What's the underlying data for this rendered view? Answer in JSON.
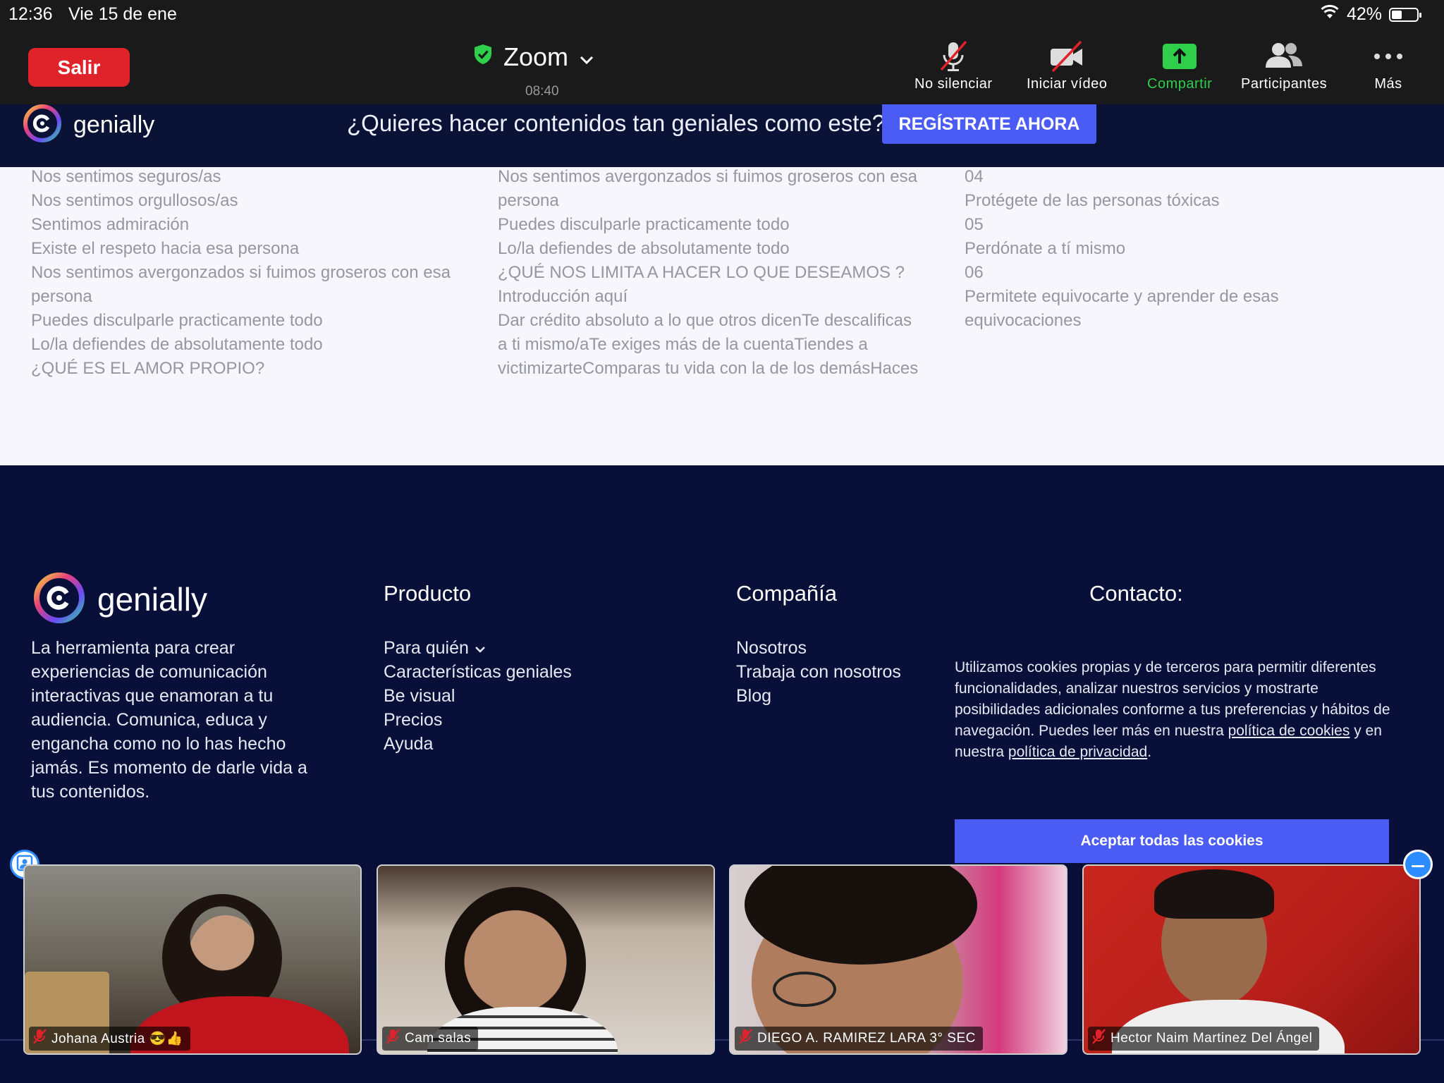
{
  "status_bar": {
    "time": "12:36",
    "date": "Vie 15 de ene",
    "battery": "42%",
    "battery_level": 0.42
  },
  "toolbar": {
    "leave_label": "Salir",
    "meeting_title": "Zoom",
    "meeting_time": "08:40",
    "tools": {
      "unmute": "No silenciar",
      "start_video": "Iniciar vídeo",
      "share": "Compartir",
      "participants": "Participantes",
      "more": "Más"
    },
    "share_color": "#2fcf4c",
    "leave_color": "#e0232a"
  },
  "promo": {
    "brand": "genially",
    "text": "¿Quieres hacer contenidos tan geniales como este?",
    "cta": "REGÍSTRATE AHORA"
  },
  "content": {
    "col1": [
      "Nos sentimos seguros/as",
      "Nos sentimos orgullosos/as",
      "Sentimos admiración",
      "Existe el respeto hacia esa persona",
      "Nos sentimos avergonzados si fuimos groseros con esa",
      "persona",
      "Puedes disculparle practicamente todo",
      "Lo/la defiendes de absolutamente todo",
      "¿QUÉ ES EL AMOR PROPIO?"
    ],
    "col2": [
      "Nos sentimos avergonzados si fuimos groseros con esa",
      "persona",
      "Puedes disculparle practicamente todo",
      "Lo/la defiendes de absolutamente todo",
      "¿QUÉ NOS LIMITA A HACER LO QUE DESEAMOS ?",
      "Introducción aquí",
      "Dar crédito absoluto a lo que otros dicenTe descalificas",
      "a ti mismo/aTe exiges más de la cuentaTiendes a",
      "victimizarteComparas tu vida con la de los demásHaces"
    ],
    "col3": [
      "04",
      "Protégete de las personas tóxicas",
      "05",
      "Perdónate a tí mismo",
      "06",
      "Permitete equivocarte y aprender de esas",
      "equivocaciones"
    ]
  },
  "footer": {
    "brand": "genially",
    "about": "La herramienta para crear experiencias de comunicación interactivas que enamoran a tu audiencia. Comunica, educa y engancha como no lo has hecho jamás. Es momento de darle vida a tus contenidos.",
    "product": {
      "title": "Producto",
      "links": [
        "Para quién",
        "Características geniales",
        "Be visual",
        "Precios",
        "Ayuda"
      ]
    },
    "company": {
      "title": "Compañía",
      "links": [
        "Nosotros",
        "Trabaja con nosotros",
        "Blog"
      ]
    },
    "contact": {
      "title": "Contacto:"
    },
    "cookies": {
      "text_1": "Utilizamos cookies propias y de terceros para permitir diferentes funcionalidades, analizar nuestros servicios y mostrarte posibilidades adicionales conforme a tus preferencias y hábitos de navegación. Puedes leer más en nuestra ",
      "link_1": "política de cookies",
      "text_2": " y en nuestra ",
      "link_2": "política de privacidad",
      "text_3": ".",
      "accept": "Aceptar todas las cookies"
    }
  },
  "participants": [
    {
      "name": "Johana Austria 😎👍"
    },
    {
      "name": "Cam salas"
    },
    {
      "name": "DIEGO A. RAMIREZ LARA 3° SEC"
    },
    {
      "name": "Hector Naim Martinez Del Ángel"
    }
  ],
  "icons": {
    "shield": "shield-check-icon",
    "chevron": "chevron-down-icon",
    "mic": "mic-muted-icon",
    "video": "video-off-icon",
    "share": "share-screen-icon",
    "participants": "participants-icon",
    "more": "more-dots-icon",
    "wifi": "wifi-icon",
    "battery": "battery-icon"
  }
}
